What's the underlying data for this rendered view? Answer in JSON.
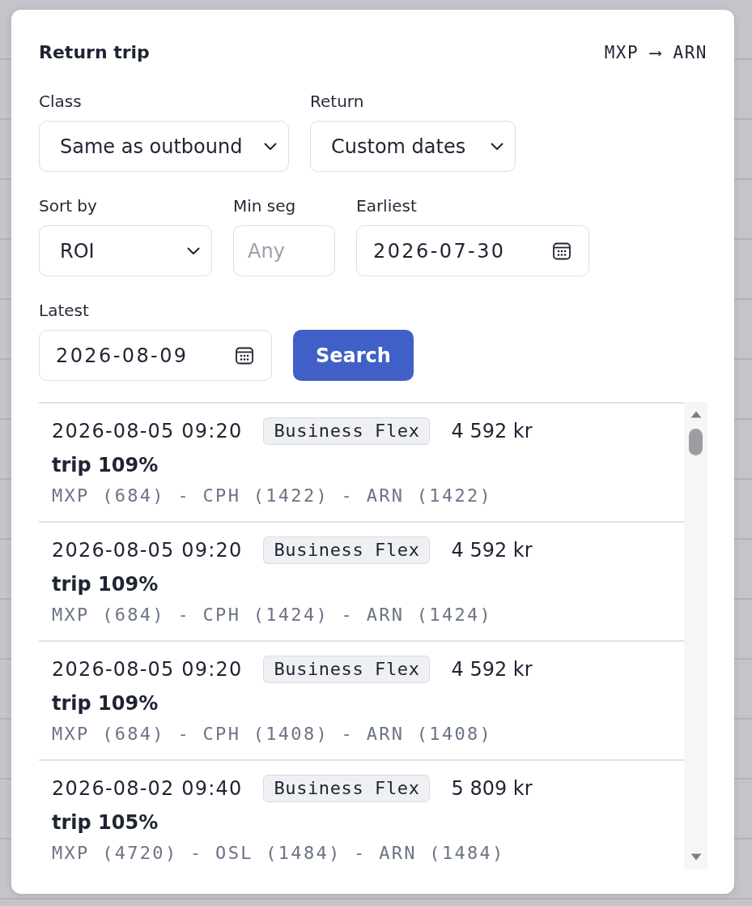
{
  "dialog": {
    "title": "Return trip",
    "route": "MXP ⟶ ARN"
  },
  "filters": [
    {
      "kind": "select",
      "label": "Class",
      "value": "Same as outbound"
    },
    {
      "kind": "select",
      "label": "Return",
      "value": "Custom dates"
    },
    {
      "kind": "select",
      "label": "Sort by",
      "value": "ROI"
    },
    {
      "kind": "number",
      "label": "Min seg",
      "placeholder": "Any"
    },
    {
      "kind": "date",
      "label": "Earliest",
      "value": "2026-07-30"
    },
    {
      "kind": "date",
      "label": "Latest",
      "value": "2026-08-09"
    }
  ],
  "search_button": {
    "label": "Search"
  },
  "results": [
    {
      "departure": "2026-08-05 09:20",
      "fare": "Business Flex",
      "price": "4 592 kr",
      "score": "trip 109%",
      "route": "MXP (684) - CPH (1422) - ARN (1422)"
    },
    {
      "departure": "2026-08-05 09:20",
      "fare": "Business Flex",
      "price": "4 592 kr",
      "score": "trip 109%",
      "route": "MXP (684) - CPH (1424) - ARN (1424)"
    },
    {
      "departure": "2026-08-05 09:20",
      "fare": "Business Flex",
      "price": "4 592 kr",
      "score": "trip 109%",
      "route": "MXP (684) - CPH (1408) - ARN (1408)"
    },
    {
      "departure": "2026-08-02 09:40",
      "fare": "Business Flex",
      "price": "5 809 kr",
      "score": "trip 105%",
      "route": "MXP (4720) - OSL (1484) - ARN (1484)"
    }
  ]
}
